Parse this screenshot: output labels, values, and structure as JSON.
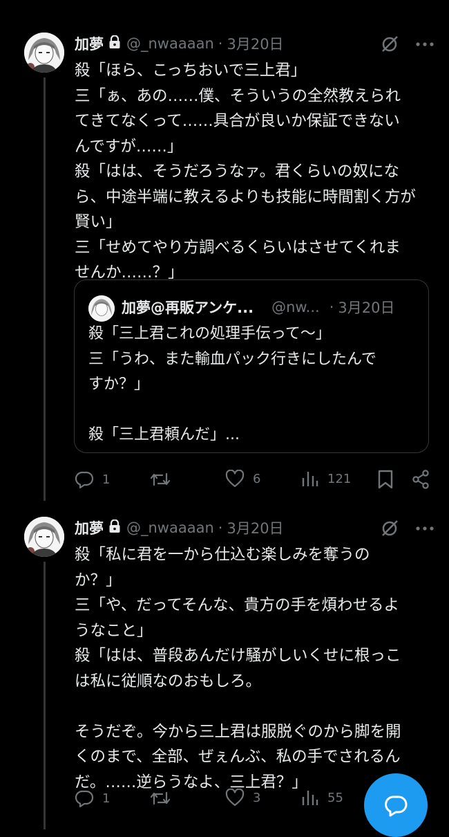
{
  "tweets": [
    {
      "author": "加夢",
      "handle": "@_nwaaaan",
      "separator": "·",
      "date": "3月20日",
      "text": "殺「ほら、こっちおいで三上君」\n三「ぁ、あの……僕、そういうの全然教えられ\nてきてなくって……具合が良いか保証できない\nんですが……」\n殺「はは、そうだろうなァ。君くらいの奴にな\nら、中途半端に教えるよりも技能に時間割く方が\n賢い」\n三「せめてやり方調べるくらいはさせてくれま\nせんか……？」",
      "quote": {
        "author": "加夢@再販アンケ...",
        "handle": "@nw...",
        "separator": "·",
        "date": "3月20日",
        "text": "殺「三上君これの処理手伝って〜」\n三「うわ、また輸血パック行きにしたんで\nすか？」\n\n殺「三上君頼んだ」..."
      },
      "stats": {
        "replies": "1",
        "retweets": "",
        "likes": "6",
        "views": "121"
      }
    },
    {
      "author": "加夢",
      "handle": "@_nwaaaan",
      "separator": "·",
      "date": "3月20日",
      "text": "殺「私に君を一から仕込む楽しみを奪うの\nか？」\n三「や、だってそんな、貴方の手を煩わせるよ\nうなこと」\n殺「はは、普段あんだけ騒がしいくせに根っこ\nは私に従順なのおもしろ。\n\nそうだぞ。今から三上君は服脱ぐのから脚を開\nくのまで、全部、ぜぇんぶ、私の手でされるん\nだ。……逆らうなよ、三上君？」",
      "stats": {
        "replies": "1",
        "retweets": "",
        "likes": "3",
        "views": "55"
      }
    }
  ],
  "icons": {
    "grok": "grok-icon",
    "more": "more-icon",
    "reply": "reply-icon",
    "retweet": "retweet-icon",
    "like": "like-icon",
    "views": "views-icon",
    "bookmark": "bookmark-icon",
    "share": "share-icon",
    "compose": "compose-icon"
  },
  "colors": {
    "background": "#000000",
    "text": "#e7e9ea",
    "muted": "#71767b",
    "accent": "#1d9bf0"
  }
}
